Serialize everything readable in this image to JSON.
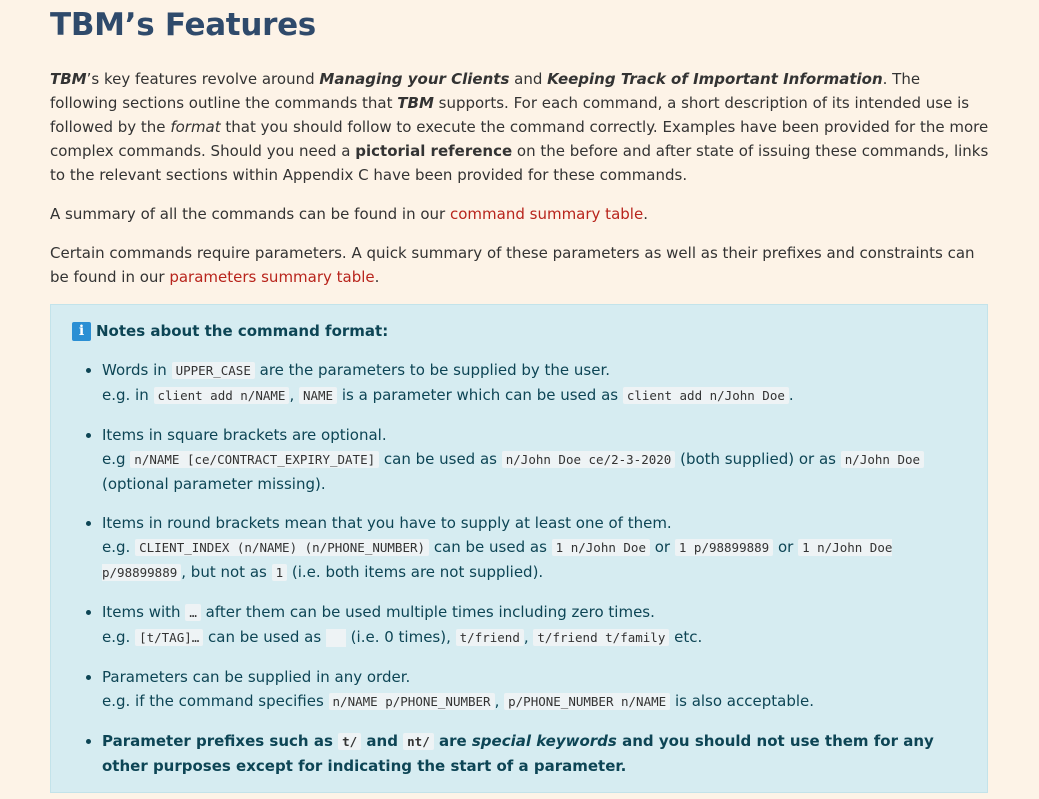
{
  "heading": "TBM’s Features",
  "intro": {
    "t1": "TBM",
    "t2": "’s key features revolve around ",
    "t3": "Managing your Clients",
    "t4": " and ",
    "t5": "Keeping Track of Important Information",
    "t6": ". The following sections outline the commands that ",
    "t7": "TBM",
    "t8": " supports. For each command, a short description of its intended use is followed by the ",
    "t9": "format",
    "t10": " that you should follow to execute the command correctly. Examples have been provided for the more complex commands. Should you need a ",
    "t11": "pictorial reference",
    "t12": " on the before and after state of issuing these commands, links to the relevant sections within Appendix C have been provided for these commands."
  },
  "summary": {
    "before": "A summary of all the commands can be found in our ",
    "link": "command summary table",
    "after": "."
  },
  "params": {
    "before": "Certain commands require parameters. A quick summary of these parameters as well as their prefixes and constraints can be found in our ",
    "link": "parameters summary table",
    "after": "."
  },
  "notes": {
    "icon": "i",
    "title": "Notes about the command format:",
    "b1": {
      "a": "Words in ",
      "c1": "UPPER_CASE",
      "b": " are the parameters to be supplied by the user.",
      "c": "e.g. in ",
      "c2": "client add n/NAME",
      "d": ", ",
      "c3": "NAME",
      "e": " is a parameter which can be used as ",
      "c4": "client add n/John Doe",
      "f": "."
    },
    "b2": {
      "a": "Items in square brackets are optional.",
      "b": "e.g ",
      "c1": "n/NAME [ce/CONTRACT_EXPIRY_DATE]",
      "c": " can be used as ",
      "c2": "n/John Doe ce/2-3-2020",
      "d": " (both supplied) or as ",
      "c3": "n/John Doe",
      "e": " (optional parameter missing)."
    },
    "b3": {
      "a": "Items in round brackets mean that you have to supply at least one of them.",
      "b": "e.g. ",
      "c1": "CLIENT_INDEX (n/NAME) (n/PHONE_NUMBER)",
      "c": " can be used as ",
      "c2": "1 n/John Doe",
      "d": " or ",
      "c3": "1 p/98899889",
      "e": " or ",
      "c4": "1 n/John Doe p/98899889",
      "f": ", but not as ",
      "c5": "1",
      "g": " (i.e. both items are not supplied)."
    },
    "b4": {
      "a": "Items with ",
      "c1": "…",
      "b": " after them can be used multiple times including zero times.",
      "c": "e.g. ",
      "c2": "[t/TAG]…",
      "d": " can be used as ",
      "e": " (i.e. 0 times), ",
      "c3": "t/friend",
      "f": ", ",
      "c4": "t/friend t/family",
      "g": " etc."
    },
    "b5": {
      "a": "Parameters can be supplied in any order.",
      "b": "e.g. if the command specifies ",
      "c1": "n/NAME p/PHONE_NUMBER",
      "c": ", ",
      "c2": "p/PHONE_NUMBER n/NAME",
      "d": " is also acceptable."
    },
    "b6": {
      "a": "Parameter prefixes such as ",
      "c1": "t/",
      "b": " and ",
      "c2": "nt/",
      "c": " are ",
      "d": "special keywords",
      "e": " and you should not use them for any other purposes except for indicating the start of a parameter."
    }
  }
}
